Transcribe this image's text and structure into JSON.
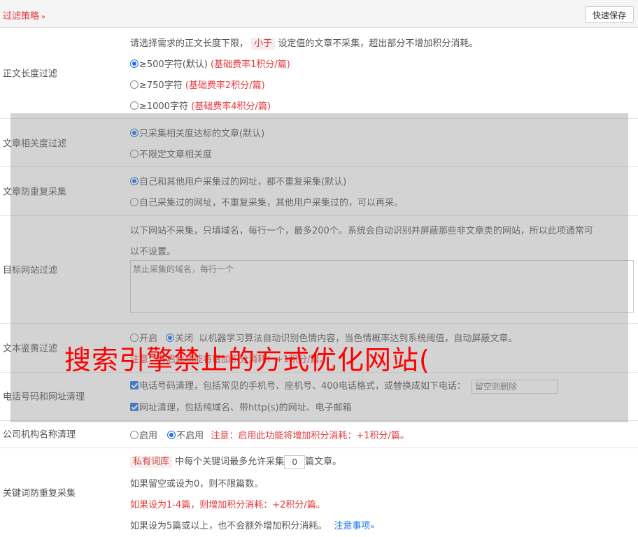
{
  "header": {
    "title": "过滤策略",
    "chevron": "»",
    "save_label": "快速保存"
  },
  "length_filter": {
    "label": "正文长度过滤",
    "intro_before": "请选择需求的正文长度下限，",
    "intro_tag": "小于",
    "intro_after": "设定值的文章不采集，超出部分不增加积分消耗。",
    "options": [
      {
        "text": "≥500字符(默认)",
        "cost": "(基础费率1积分/篇)",
        "checked": true
      },
      {
        "text": "≥750字符",
        "cost": "(基础费率2积分/篇)",
        "checked": false
      },
      {
        "text": "≥1000字符",
        "cost": "(基础费率4积分/篇)",
        "checked": false
      }
    ]
  },
  "relevance": {
    "label": "文章相关度过滤",
    "options": [
      {
        "text": "只采集相关度达标的文章(默认)",
        "checked": true
      },
      {
        "text": "不限定文章相关度",
        "checked": false
      }
    ]
  },
  "dedup": {
    "label": "文章防重复采集",
    "options": [
      {
        "text": "自己和其他用户采集过的网址，都不重复采集(默认)",
        "checked": true
      },
      {
        "text": "自己采集过的网址，不重复采集，其他用户采集过的，可以再采。",
        "checked": false
      }
    ]
  },
  "site_filter": {
    "label": "目标网站过滤",
    "desc_line1": "以下网站不采集，只填域名，每行一个，最多200个。系统会自动识别并屏蔽那些非文章类的网站，所以此项通常可",
    "desc_line2": "以不设置。",
    "placeholder": "禁止采集的域名，每行一个"
  },
  "porn_filter": {
    "label": "文本鉴黄过滤",
    "on_label": "开启",
    "off_label": "关闭",
    "desc": "以机器学习算法自动识别色情内容，当色情概率达到系统阈值，自动屏蔽文章。",
    "note": "注意：开启此功能将增加积分消耗：+1积分/篇。"
  },
  "contact_clean": {
    "label": "电话号码和网址清理",
    "phone_text": "电话号码清理，包括常见的手机号、座机号、400电话格式，或替换成如下电话：",
    "phone_placeholder": "留空则删除",
    "url_text": "网址清理，包括纯域名、带http(s)的网址、电子邮箱"
  },
  "org_clean": {
    "label": "公司机构名称清理",
    "enable_label": "启用",
    "disable_label": "不启用",
    "note": "注意：启用此功能将增加积分消耗：+1积分/篇。"
  },
  "keyword_dedup": {
    "label": "关键词防重复采集",
    "tag": "私有词库",
    "text_before": "中每个关键词最多允许采集",
    "value": "0",
    "text_after": "篇文章。",
    "line2": "如果留空或设为0，则不限篇数。",
    "line3": "如果设为1-4篇，则增加积分消耗：+2积分/篇。",
    "line4": "如果设为5篇或以上，也不会额外增加积分消耗。",
    "notes_link": "注意事项",
    "notes_chevron": "»"
  },
  "watermark": "搜索引擎禁止的方式优化网站(",
  "colors": {
    "accent_red": "#e4393c",
    "link_blue": "#1a73e8"
  }
}
